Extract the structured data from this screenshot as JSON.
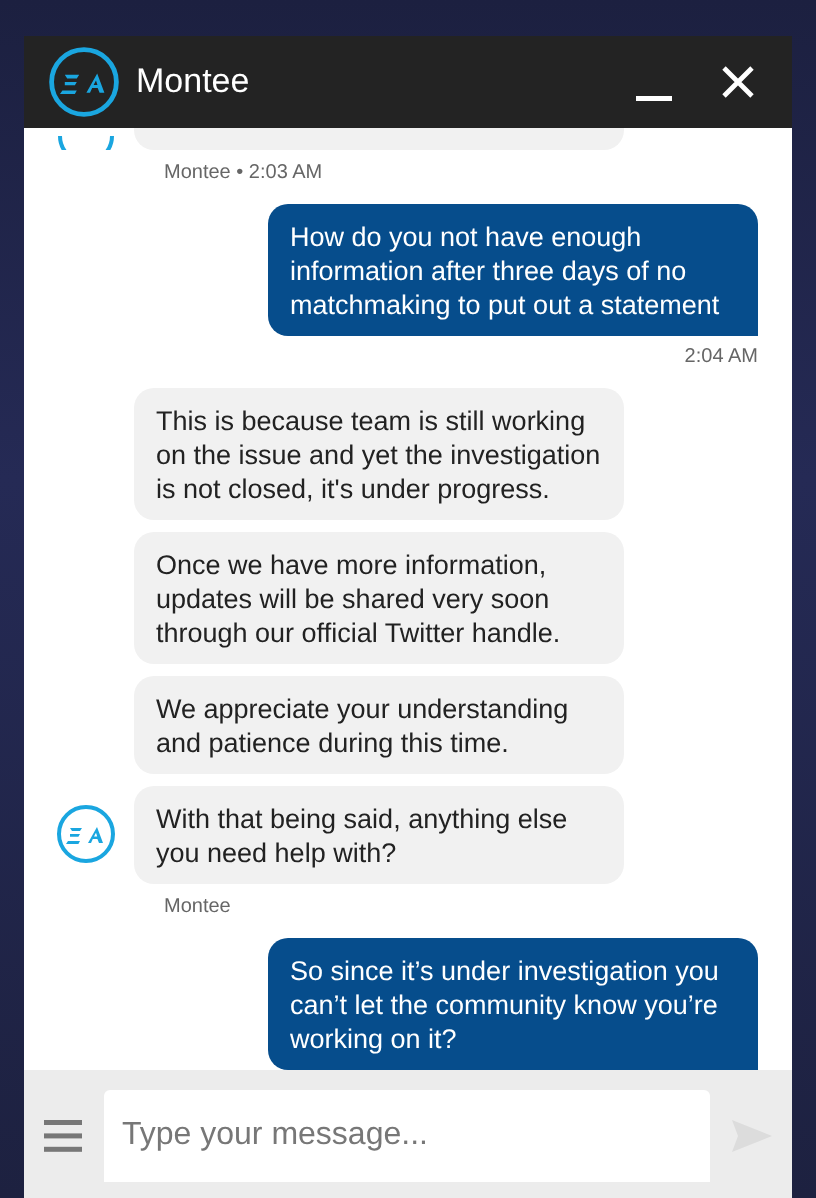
{
  "window": {
    "title": "Montee"
  },
  "messages": [
    {
      "kind": "agent_cut",
      "meta": "Montee • 2:03 AM"
    },
    {
      "kind": "user",
      "bubbles": [
        "How do you not have enough information after three days of no matchmaking to put out a statement"
      ],
      "meta": "2:04 AM"
    },
    {
      "kind": "agent",
      "bubbles": [
        "This is because team is still working on the issue and yet the investigation is not closed, it's under progress.",
        "Once we have more information, updates will be shared very soon through our official Twitter handle.",
        "We appreciate your understanding and patience during this time.",
        "With that being said, anything else you need help with?"
      ],
      "meta": "Montee"
    },
    {
      "kind": "user",
      "bubbles": [
        "So since it’s under investigation you can’t let the community know you’re working on it?"
      ]
    }
  ],
  "composer": {
    "placeholder": "Type your message..."
  }
}
